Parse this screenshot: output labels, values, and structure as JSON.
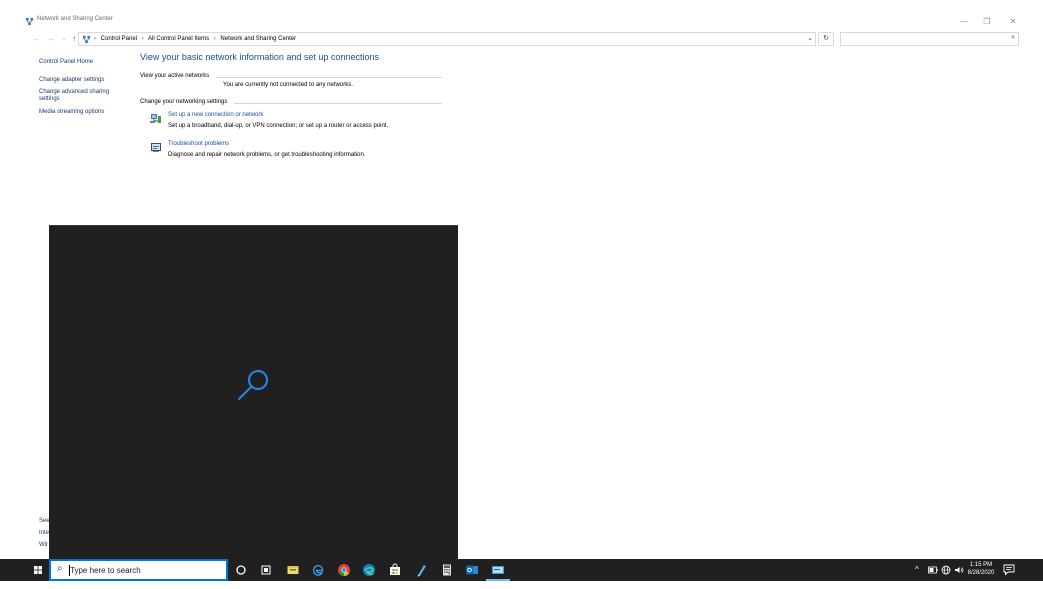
{
  "window": {
    "title": "Network and Sharing Center",
    "controls": {
      "minimize": "—",
      "maximize": "❐",
      "close": "✕"
    }
  },
  "address_bar": {
    "crumbs": [
      "Control Panel",
      "All Control Panel Items",
      "Network and Sharing Center"
    ],
    "separator": "›",
    "search_placeholder": ""
  },
  "nav_buttons": {
    "back": "←",
    "forward": "→",
    "recent": "⌄",
    "up": "↑",
    "dropdown": "⌄",
    "refresh": "↻",
    "search_icon": "⌕"
  },
  "left_nav": {
    "home": "Control Panel Home",
    "items": [
      "Change adapter settings",
      "Change advanced sharing settings",
      "Media streaming options"
    ],
    "see_also_partial": [
      "See",
      "Inte",
      "Wir"
    ]
  },
  "main": {
    "heading": "View your basic network information and set up connections",
    "active_networks_label": "View your active networks",
    "not_connected": "You are currently not connected to any networks.",
    "change_settings_label": "Change your networking settings",
    "tasks": [
      {
        "link": "Set up a new connection or network",
        "desc": "Set up a broadband, dial-up, or VPN connection; or set up a router or access point.",
        "icon": "network-setup-icon"
      },
      {
        "link": "Troubleshoot problems",
        "desc": "Diagnose and repair network problems, or get troubleshooting information.",
        "icon": "troubleshoot-icon"
      }
    ]
  },
  "search_flyout": {
    "icon": "search-icon",
    "bg": "#202020",
    "accent": "#0078d7"
  },
  "taskbar": {
    "search_placeholder": "Type here to search",
    "pinned": [
      "cortana-icon",
      "task-view-icon",
      "file-explorer-icon",
      "edge-legacy-icon",
      "chrome-icon",
      "edge-icon",
      "store-icon",
      "notepad-icon",
      "calculator-icon",
      "outlook-icon",
      "remote-desktop-icon"
    ],
    "tray": {
      "chevron": "^",
      "time": "1:15 PM",
      "date": "8/28/2020"
    }
  },
  "colors": {
    "link": "#1a4d9a",
    "heading": "#1a4d9a",
    "taskbar": "#202020",
    "search_border": "#0078d7"
  }
}
